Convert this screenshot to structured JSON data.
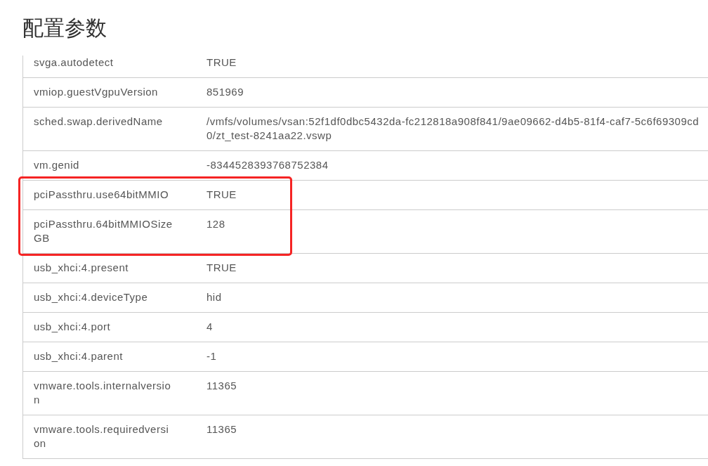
{
  "title": "配置参数",
  "parameters": [
    {
      "name": "svga.autodetect",
      "value": "TRUE",
      "highlighted": false
    },
    {
      "name": "vmiop.guestVgpuVersion",
      "value": "851969",
      "highlighted": false
    },
    {
      "name": "sched.swap.derivedName",
      "value": "/vmfs/volumes/vsan:52f1df0dbc5432da-fc212818a908f841/9ae09662-d4b5-81f4-caf7-5c6f69309cd0/zt_test-8241aa22.vswp",
      "highlighted": false
    },
    {
      "name": "vm.genid",
      "value": "-8344528393768752384",
      "highlighted": false
    },
    {
      "name": "pciPassthru.use64bitMMIO",
      "value": "TRUE",
      "highlighted": true
    },
    {
      "name": "pciPassthru.64bitMMIOSizeGB",
      "value": "128",
      "highlighted": true
    },
    {
      "name": "usb_xhci:4.present",
      "value": "TRUE",
      "highlighted": false
    },
    {
      "name": "usb_xhci:4.deviceType",
      "value": "hid",
      "highlighted": false
    },
    {
      "name": "usb_xhci:4.port",
      "value": "4",
      "highlighted": false
    },
    {
      "name": "usb_xhci:4.parent",
      "value": "-1",
      "highlighted": false
    },
    {
      "name": "vmware.tools.internalversion",
      "value": "11365",
      "highlighted": false
    },
    {
      "name": "vmware.tools.requiredversion",
      "value": "11365",
      "highlighted": false
    }
  ]
}
